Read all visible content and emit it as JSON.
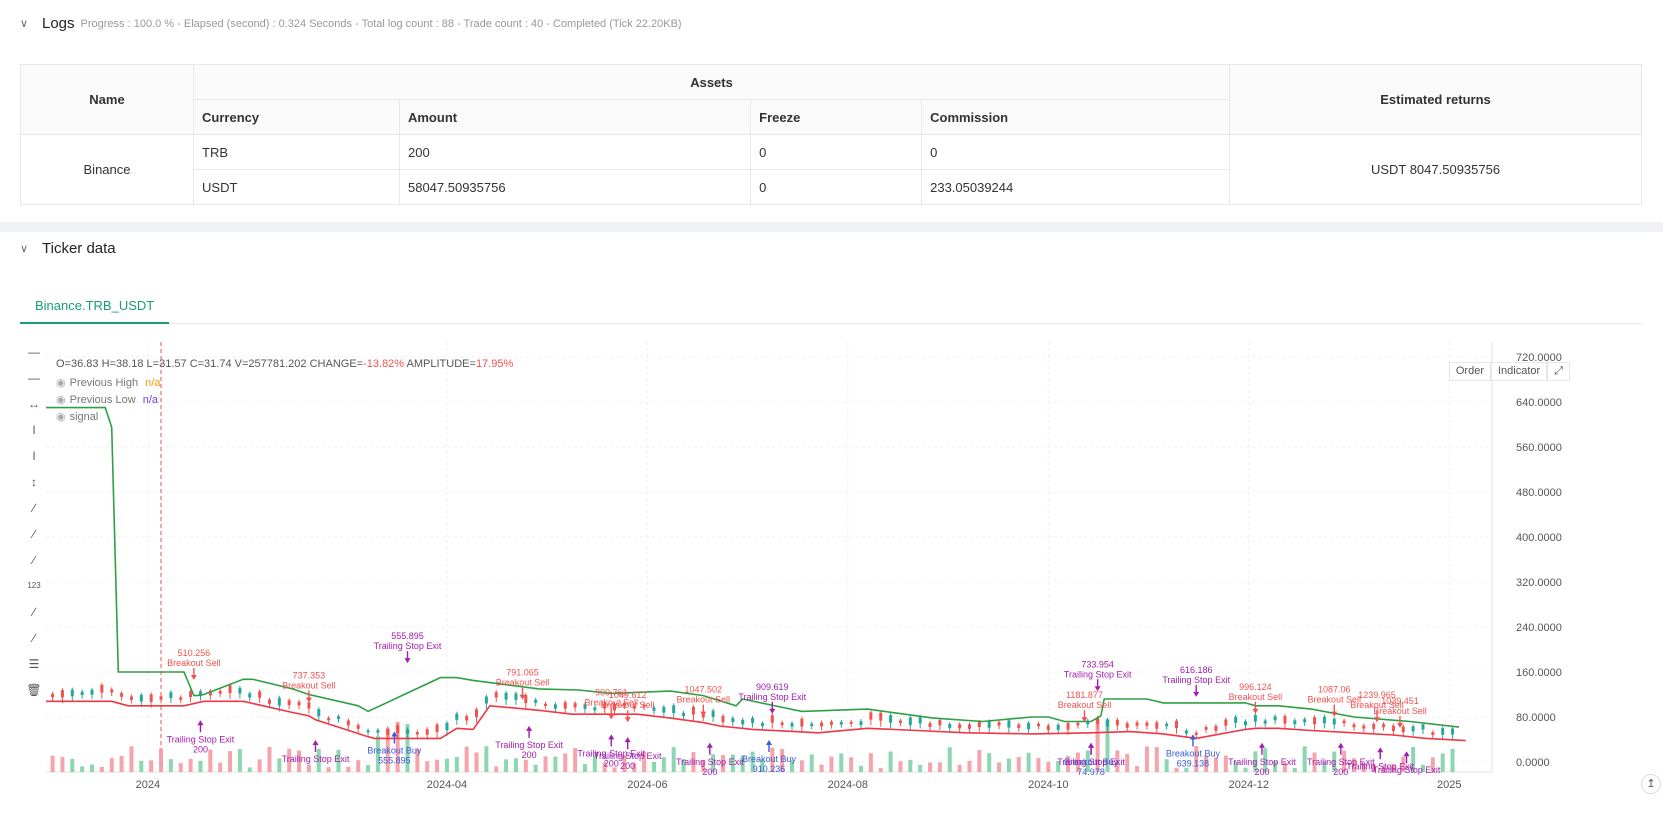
{
  "logs": {
    "title": "Logs",
    "status": "Progress : 100.0 % - Elapsed (second) : 0.324  Seconds - Total log count : 88 - Trade count : 40 - Completed (Tick 22.20KB)"
  },
  "assets_table": {
    "header_name": "Name",
    "header_assets": "Assets",
    "header_returns": "Estimated returns",
    "col_currency": "Currency",
    "col_amount": "Amount",
    "col_freeze": "Freeze",
    "col_commission": "Commission",
    "exchange": "Binance",
    "rows": [
      {
        "currency": "TRB",
        "amount": "200",
        "freeze": "0",
        "commission": "0"
      },
      {
        "currency": "USDT",
        "amount": "58047.50935756",
        "freeze": "0",
        "commission": "233.05039244"
      }
    ],
    "estimated_returns": "USDT 8047.50935756"
  },
  "ticker": {
    "title": "Ticker data",
    "tab": "Binance.TRB_USDT",
    "ohlc": {
      "o": "O=36.83",
      "h": "H=38.18",
      "l": "L=31.57",
      "c": "C=31.74",
      "v": "V=257781.202",
      "change_label": "CHANGE=",
      "change": "-13.82%",
      "amp_label": "AMPLITUDE=",
      "amp": "17.95%"
    },
    "legend": [
      {
        "name": "Previous High",
        "value": "n/a",
        "color": "#f59e0b"
      },
      {
        "name": "Previous Low",
        "value": "n/a",
        "color": "#7c3aed"
      },
      {
        "name": "signal",
        "value": "",
        "color": "#777777"
      }
    ],
    "btn_order": "Order",
    "btn_indicator": "Indicator",
    "fullscreen_icon": "expand-icon",
    "corner_icon": "scroll-top-icon"
  },
  "chart_data": {
    "type": "line",
    "y_ticks": [
      "720.0000",
      "640.0000",
      "560.0000",
      "480.0000",
      "400.0000",
      "320.0000",
      "240.0000",
      "160.0000",
      "80.0000",
      "0.0000"
    ],
    "x_ticks": [
      "2024",
      "2024-04",
      "2024-06",
      "2024-08",
      "2024-10",
      "2024-12",
      "2025"
    ],
    "ylim": [
      0,
      720
    ],
    "x_labels_days": [
      31,
      122,
      183,
      244,
      305,
      366,
      427
    ],
    "x_range_days": [
      0,
      440
    ],
    "series": [
      {
        "name": "Previous High",
        "color": "#2ea043",
        "x": [
          0,
          18,
          20,
          22,
          42,
          45,
          46,
          48,
          60,
          63,
          75,
          80,
          80,
          95,
          98,
          120,
          125,
          130,
          150,
          162,
          172,
          190,
          200,
          210,
          212,
          225,
          230,
          250,
          270,
          285,
          300,
          305,
          310,
          318,
          321,
          322,
          335,
          340,
          365,
          368,
          375,
          385,
          398,
          415,
          430
        ],
        "y": [
          630,
          630,
          595,
          160,
          160,
          118,
          118,
          120,
          147,
          147,
          130,
          120,
          120,
          100,
          90,
          150,
          150,
          145,
          130,
          128,
          122,
          126,
          118,
          100,
          112,
          96,
          90,
          94,
          78,
          72,
          80,
          80,
          72,
          72,
          82,
          112,
          112,
          105,
          105,
          100,
          100,
          94,
          80,
          72,
          62
        ]
      },
      {
        "name": "Previous Low",
        "color": "#f23645",
        "x": [
          0,
          20,
          25,
          42,
          48,
          60,
          75,
          80,
          82,
          98,
          100,
          120,
          125,
          130,
          135,
          150,
          160,
          180,
          190,
          200,
          205,
          215,
          225,
          235,
          250,
          265,
          280,
          300,
          318,
          330,
          340,
          350,
          365,
          368,
          375,
          385,
          398,
          410,
          420,
          432
        ],
        "y": [
          108,
          108,
          100,
          100,
          108,
          108,
          88,
          82,
          75,
          45,
          42,
          42,
          60,
          58,
          100,
          92,
          85,
          85,
          78,
          70,
          64,
          58,
          55,
          52,
          60,
          56,
          52,
          50,
          52,
          54,
          50,
          42,
          58,
          60,
          60,
          56,
          52,
          48,
          42,
          38
        ]
      }
    ],
    "signals": [
      {
        "type": "Breakout Sell",
        "x": 45,
        "y": 160,
        "price": "510.256"
      },
      {
        "type": "Trailing Stop Exit",
        "x": 47,
        "y": 60,
        "qty": "200"
      },
      {
        "type": "Breakout Sell",
        "x": 80,
        "y": 120,
        "price": "737.353"
      },
      {
        "type": "Trailing Stop Exit",
        "x": 82,
        "y": 25,
        "qty": ""
      },
      {
        "type": "Trailing Stop Exit",
        "x": 110,
        "y": 190,
        "price": "555.895"
      },
      {
        "type": "Breakout Buy",
        "x": 106,
        "y": 40,
        "price": "555.895"
      },
      {
        "type": "Breakout Sell",
        "x": 145,
        "y": 125,
        "price": "791.065"
      },
      {
        "type": "Trailing Stop Exit",
        "x": 147,
        "y": 50,
        "qty": "200"
      },
      {
        "type": "Breakout Sell",
        "x": 172,
        "y": 90,
        "price": "900.761"
      },
      {
        "type": "Breakout Sell",
        "x": 177,
        "y": 85,
        "price": "1049.612"
      },
      {
        "type": "Trailing Stop Exit",
        "x": 172,
        "y": 35,
        "qty": "200"
      },
      {
        "type": "Trailing Stop Exit",
        "x": 177,
        "y": 30,
        "qty": "200"
      },
      {
        "type": "Breakout Sell",
        "x": 200,
        "y": 95,
        "price": "1047.502"
      },
      {
        "type": "Trailing Stop Exit",
        "x": 202,
        "y": 20,
        "qty": "200"
      },
      {
        "type": "Breakout Buy",
        "x": 220,
        "y": 25,
        "price": "910.236"
      },
      {
        "type": "Trailing Stop Exit",
        "x": 221,
        "y": 100,
        "price": "909.619"
      },
      {
        "type": "Breakout Sell",
        "x": 316,
        "y": 85,
        "price": "1181.877"
      },
      {
        "type": "Trailing Stop Exit",
        "x": 320,
        "y": 140,
        "price": "733.954"
      },
      {
        "type": "Breakout Buy",
        "x": 318,
        "y": 20,
        "price": "74.978"
      },
      {
        "type": "Trailing Stop Exit",
        "x": 318,
        "y": 20,
        "qty": ""
      },
      {
        "type": "Breakout Buy",
        "x": 349,
        "y": 35,
        "price": "639.138"
      },
      {
        "type": "Trailing Stop Exit",
        "x": 350,
        "y": 130,
        "price": "616.186"
      },
      {
        "type": "Breakout Sell",
        "x": 368,
        "y": 100,
        "price": "996.124"
      },
      {
        "type": "Trailing Stop Exit",
        "x": 370,
        "y": 20,
        "qty": "200"
      },
      {
        "type": "Breakout Sell",
        "x": 392,
        "y": 95,
        "price": "1087.06"
      },
      {
        "type": "Trailing Stop Exit",
        "x": 394,
        "y": 20,
        "qty": "200"
      },
      {
        "type": "Breakout Sell",
        "x": 405,
        "y": 85,
        "price": "1239.965"
      },
      {
        "type": "Breakout Sell",
        "x": 412,
        "y": 75,
        "price": "1039.451"
      },
      {
        "type": "Trailing Stop Exit",
        "x": 406,
        "y": 12,
        "qty": ""
      },
      {
        "type": "Trailing Stop Exit",
        "x": 414,
        "y": 5,
        "qty": ""
      }
    ],
    "marker_x_day": 35,
    "grid": true
  }
}
